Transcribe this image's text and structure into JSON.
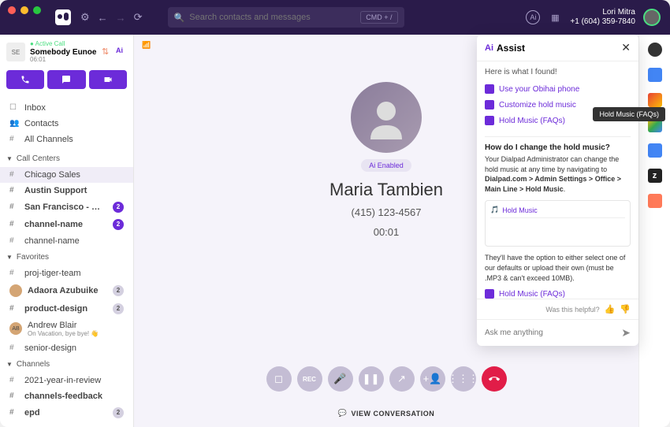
{
  "topbar": {
    "search_placeholder": "Search contacts and messages",
    "cmd_hint": "CMD + /",
    "user_name": "Lori Mitra",
    "user_phone": "+1 (604) 359-7840"
  },
  "active_call": {
    "status": "Active Call",
    "name": "Somebody Eunoe",
    "time": "06:01"
  },
  "sidebar": {
    "inbox": "Inbox",
    "contacts": "Contacts",
    "all_channels": "All Channels",
    "sections": {
      "call_centers": {
        "label": "Call Centers",
        "items": [
          {
            "label": "Chicago Sales",
            "selected": true,
            "bold": false
          },
          {
            "label": "Austin Support",
            "bold": true
          },
          {
            "label": "San Francisco - Main",
            "bold": true,
            "badge": "2"
          },
          {
            "label": "channel-name",
            "bold": true,
            "badge": "2"
          },
          {
            "label": "channel-name"
          }
        ]
      },
      "favorites": {
        "label": "Favorites",
        "items": [
          {
            "label": "proj-tiger-team",
            "hash": true
          },
          {
            "label": "Adaora Azubuike",
            "avatar": true,
            "bold": true,
            "badge": "2",
            "badge_gray": true
          },
          {
            "label": "product-design",
            "hash": true,
            "bold": true,
            "badge": "2",
            "badge_gray": true
          },
          {
            "label": "Andrew Blair",
            "avatar": true,
            "sub": "On Vacation, bye bye! 👋",
            "initials": "AB"
          },
          {
            "label": "senior-design",
            "hash": true
          }
        ]
      },
      "channels": {
        "label": "Channels",
        "items": [
          {
            "label": "2021-year-in-review",
            "hash": true
          },
          {
            "label": "channels-feedback",
            "hash": true,
            "bold": true
          },
          {
            "label": "epd",
            "hash": true,
            "bold": true,
            "badge": "2",
            "badge_gray": true
          }
        ]
      }
    }
  },
  "call": {
    "ai_chip": "Ai Enabled",
    "name": "Maria Tambien",
    "number": "(415) 123-4567",
    "timer": "00:01",
    "view_conversation": "VIEW CONVERSATION"
  },
  "assist": {
    "title": "Assist",
    "found": "Here is what I found!",
    "results": [
      {
        "icon": "chat",
        "label": "Use your Obihai phone"
      },
      {
        "icon": "chat",
        "label": "Customize hold music"
      },
      {
        "icon": "doc",
        "label": "Hold Music (FAQs)"
      }
    ],
    "tooltip": "Hold Music (FAQs)",
    "answer": {
      "question": "How do I change the hold music?",
      "text_pre": "Your Dialpad Administrator can change the hold music at any time by navigating to ",
      "text_bold": "Dialpad.com > Admin Settings > Office > Main Line > Hold Music",
      "card_title": "Hold Music",
      "followup": "They'll have the option to either select one of our defaults or upload their own (must be .MP3 & can't exceed 10MB).",
      "link": "Hold Music (FAQs)"
    },
    "helpful_label": "Was this helpful?",
    "input_placeholder": "Ask me anything"
  },
  "rail_apps": [
    "profile",
    "calendar",
    "gmail",
    "drive",
    "chat",
    "zendesk",
    "hubspot"
  ]
}
